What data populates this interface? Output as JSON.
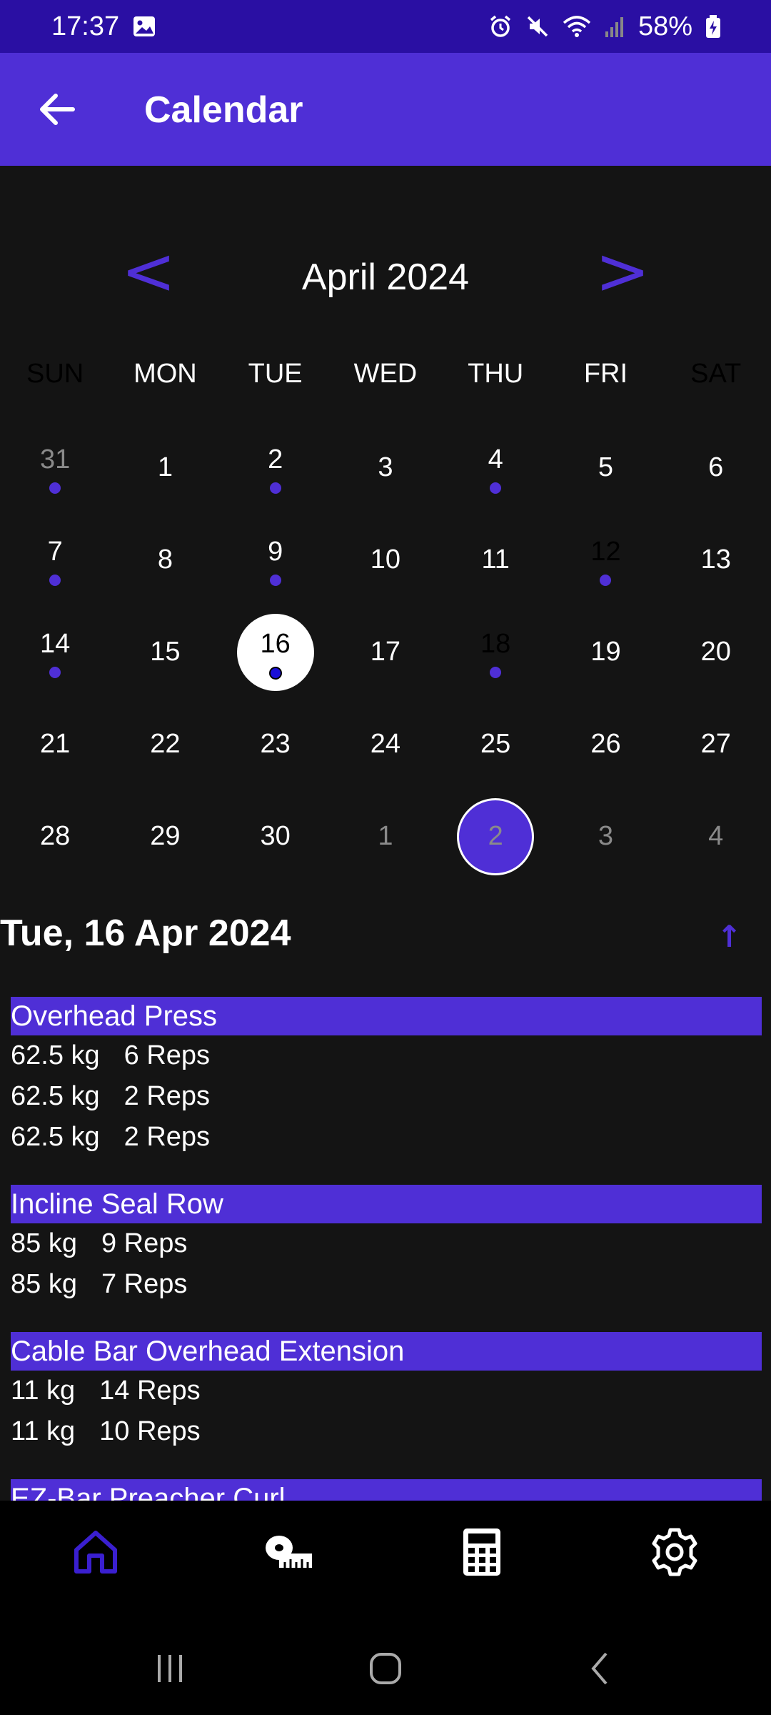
{
  "status_bar": {
    "time": "17:37",
    "battery": "58%"
  },
  "app_bar": {
    "title": "Calendar"
  },
  "calendar": {
    "month_label": "April 2024",
    "prev": "<",
    "next": ">",
    "weekdays": [
      "SUN",
      "MON",
      "TUE",
      "WED",
      "THU",
      "FRI",
      "SAT"
    ],
    "weeks": [
      [
        {
          "d": "31",
          "dot": true,
          "other": true
        },
        {
          "d": "1"
        },
        {
          "d": "2",
          "dot": true
        },
        {
          "d": "3"
        },
        {
          "d": "4",
          "dot": true
        },
        {
          "d": "5"
        },
        {
          "d": "6"
        }
      ],
      [
        {
          "d": "7",
          "dot": true
        },
        {
          "d": "8"
        },
        {
          "d": "9",
          "dot": true
        },
        {
          "d": "10"
        },
        {
          "d": "11"
        },
        {
          "d": "12",
          "dot": true,
          "dark": true
        },
        {
          "d": "13"
        }
      ],
      [
        {
          "d": "14",
          "dot": true
        },
        {
          "d": "15"
        },
        {
          "d": "16",
          "dot": true,
          "selected": true
        },
        {
          "d": "17"
        },
        {
          "d": "18",
          "dot": true,
          "dark": true
        },
        {
          "d": "19"
        },
        {
          "d": "20"
        }
      ],
      [
        {
          "d": "21"
        },
        {
          "d": "22"
        },
        {
          "d": "23"
        },
        {
          "d": "24"
        },
        {
          "d": "25"
        },
        {
          "d": "26"
        },
        {
          "d": "27"
        }
      ],
      [
        {
          "d": "28"
        },
        {
          "d": "29"
        },
        {
          "d": "30"
        },
        {
          "d": "1",
          "other": true
        },
        {
          "d": "2",
          "other": true,
          "today": true
        },
        {
          "d": "3",
          "other": true
        },
        {
          "d": "4",
          "other": true
        }
      ]
    ]
  },
  "selected_date": "Tue, 16 Apr 2024",
  "scroll_up": "↑",
  "workouts": [
    {
      "name": "Overhead Press",
      "sets": [
        {
          "weight": "62.5 kg",
          "reps": "6 Reps"
        },
        {
          "weight": "62.5 kg",
          "reps": "2 Reps"
        },
        {
          "weight": "62.5 kg",
          "reps": "2 Reps"
        }
      ]
    },
    {
      "name": "Incline Seal Row",
      "sets": [
        {
          "weight": "85 kg",
          "reps": "9 Reps"
        },
        {
          "weight": "85 kg",
          "reps": "7 Reps"
        }
      ]
    },
    {
      "name": "Cable Bar Overhead Extension",
      "sets": [
        {
          "weight": "11 kg",
          "reps": "14 Reps"
        },
        {
          "weight": "11 kg",
          "reps": "10 Reps"
        }
      ]
    },
    {
      "name": "EZ-Bar Preacher Curl",
      "sets": []
    }
  ],
  "bottom_nav": [
    "home-icon",
    "tape-measure-icon",
    "calculator-icon",
    "settings-icon"
  ],
  "colors": {
    "accent": "#4f2fd6",
    "status_bar": "#2a0fa3",
    "background": "#141414"
  }
}
